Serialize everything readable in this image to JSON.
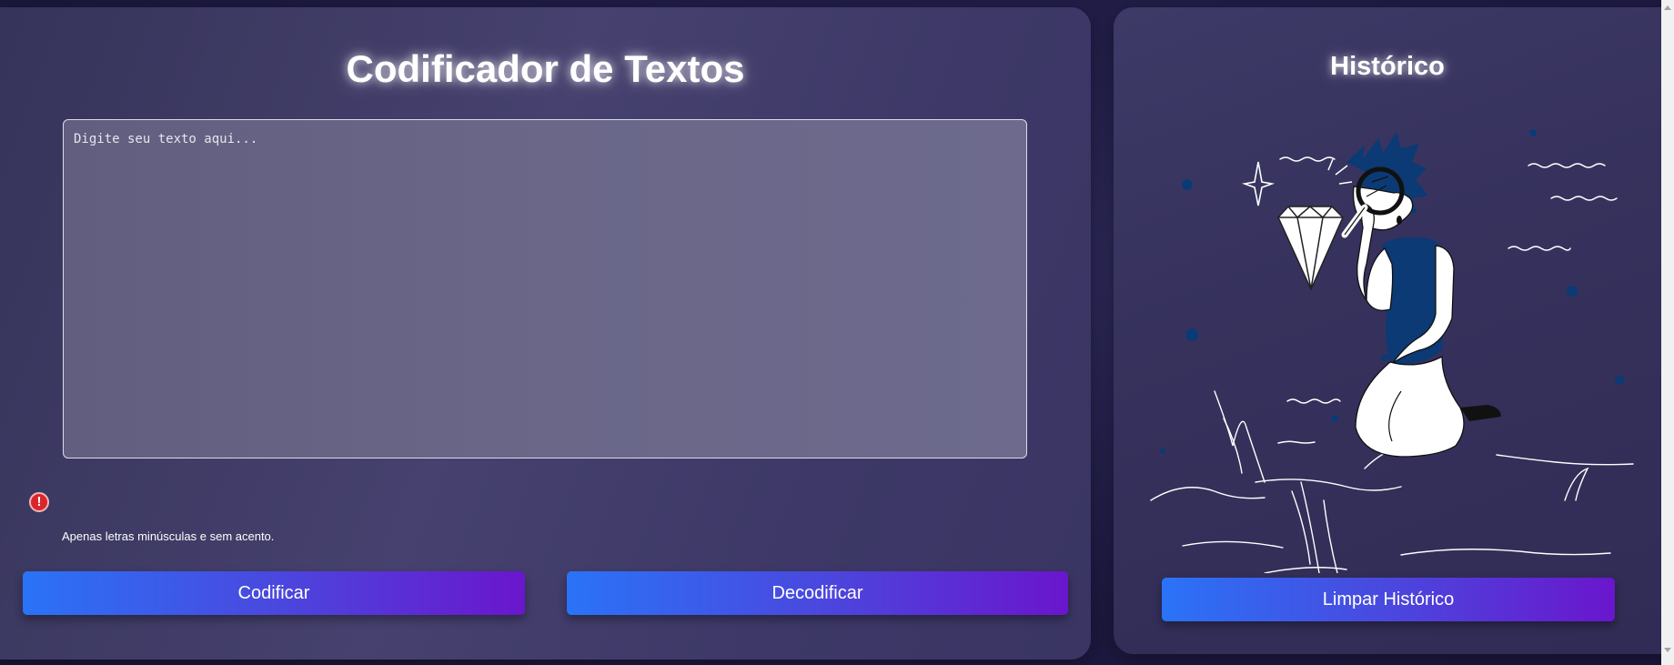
{
  "encoder": {
    "title": "Codificador de Textos",
    "input_placeholder": "Digite seu texto aqui...",
    "input_value": "",
    "warning_icon": "exclamation-circle-icon",
    "warning_text": "Apenas letras minúsculas e sem acento.",
    "encode_label": "Codificar",
    "decode_label": "Decodificar"
  },
  "history": {
    "title": "Histórico",
    "illustration": "person-examining-diamond-with-magnifier",
    "clear_label": "Limpar Histórico"
  },
  "colors": {
    "button_gradient_start": "#2a73f7",
    "button_gradient_end": "#6a16cc",
    "warning": "#d9262b",
    "illustration_accent": "#0b3a75"
  }
}
